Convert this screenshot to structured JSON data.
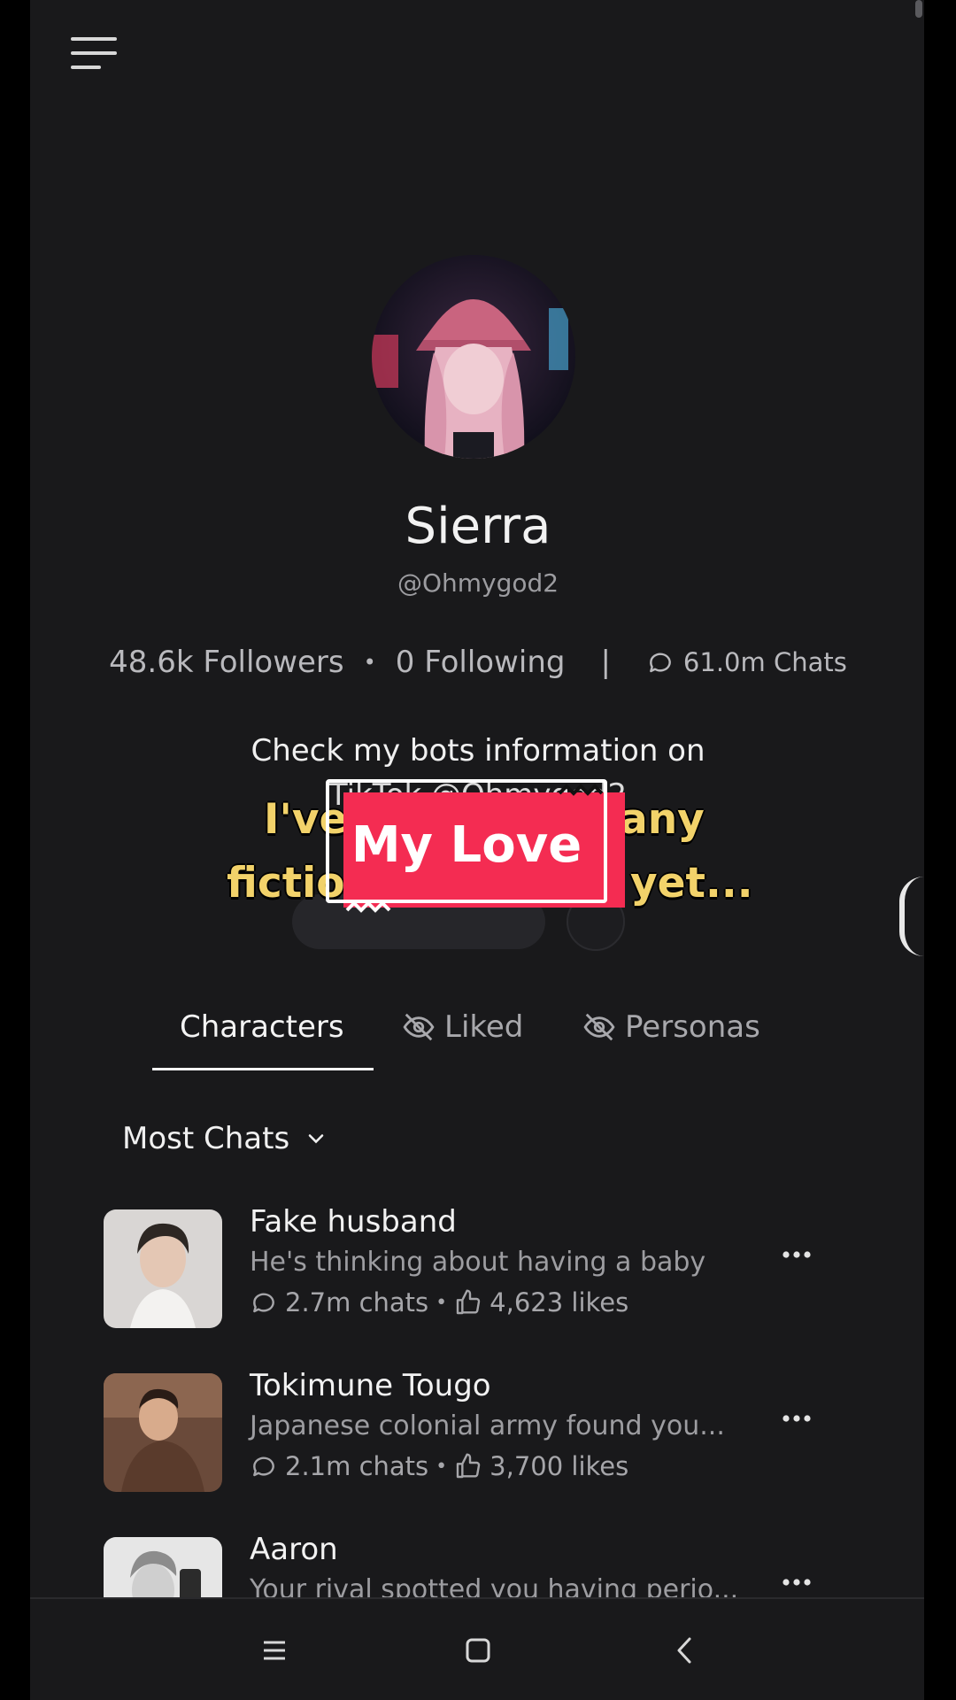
{
  "profile": {
    "name": "Sierra",
    "handle": "@Ohmygod2",
    "followers": "48.6k Followers",
    "following": "0 Following",
    "chats": "61.0m Chats",
    "bio_line1": "Check my bots information on",
    "bio_line2": "TikTok @Ohmygod2"
  },
  "overlay": {
    "caption_line1_left": "I've",
    "caption_line1_right": "any",
    "caption_line2_left": "fictio",
    "caption_line2_right": "yet...",
    "sticker_text": "My Love"
  },
  "tabs": [
    {
      "label": "Characters",
      "active": true
    },
    {
      "label": "Liked",
      "active": false
    },
    {
      "label": "Personas",
      "active": false
    }
  ],
  "sort": {
    "label": "Most Chats"
  },
  "characters": [
    {
      "title": "Fake husband",
      "desc": "He's thinking about having a baby",
      "chats": "2.7m chats",
      "likes": "4,623 likes"
    },
    {
      "title": "Tokimune Tougo",
      "desc": "Japanese colonial army found you...",
      "chats": "2.1m chats",
      "likes": "3,700 likes"
    },
    {
      "title": "Aaron",
      "desc": "Your rival spotted you having perio...",
      "chats": "",
      "likes": ""
    }
  ],
  "separator_dot": "•",
  "separator_bar": "|",
  "icons": {
    "menu": "menu-icon",
    "chat": "chat-bubble-icon",
    "like": "thumbs-up-icon",
    "hidden": "eye-off-icon",
    "more": "more-icon",
    "chevron": "chevron-down-icon"
  },
  "colors": {
    "background": "#19191b",
    "caption": "#f2d26a",
    "sticker": "#f42c52"
  }
}
